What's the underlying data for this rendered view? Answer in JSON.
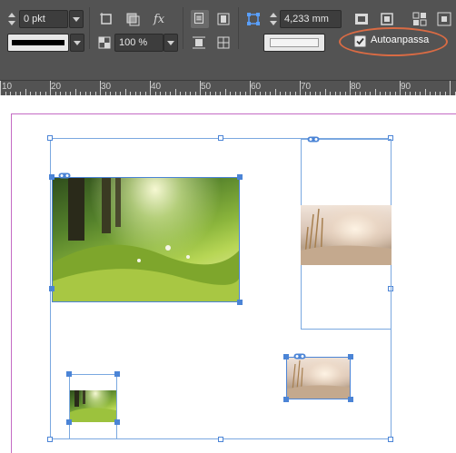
{
  "toolbar": {
    "stroke_weight": "0 pkt",
    "opacity": "100 %",
    "dimension": "4,233 mm",
    "autofit_label": "Autoanpassa",
    "autofit_checked": true,
    "accent_color": "#d96b44",
    "icons": [
      "stroke-weight-spinner",
      "rectangle-frame-icon",
      "drop-shadow-icon",
      "effects-fx-icon",
      "align-center-icon",
      "align-frame-icon",
      "bounding-box-icon",
      "fit-content-icon",
      "fit-frame-icon",
      "fill-proportionally-icon",
      "center-content-icon",
      "opacity-icon",
      "text-wrap-icon"
    ]
  },
  "ruler": {
    "labels": [
      "10",
      "20",
      "30",
      "40",
      "50",
      "60",
      "70",
      "80",
      "90"
    ]
  },
  "canvas": {
    "page_guide_color": "#c46bc4",
    "frame_color": "#4b84d6",
    "images": [
      "forest-sunlight-photo",
      "meadow-grass-photo",
      "forest-sunlight-photo",
      "meadow-grass-photo"
    ]
  }
}
